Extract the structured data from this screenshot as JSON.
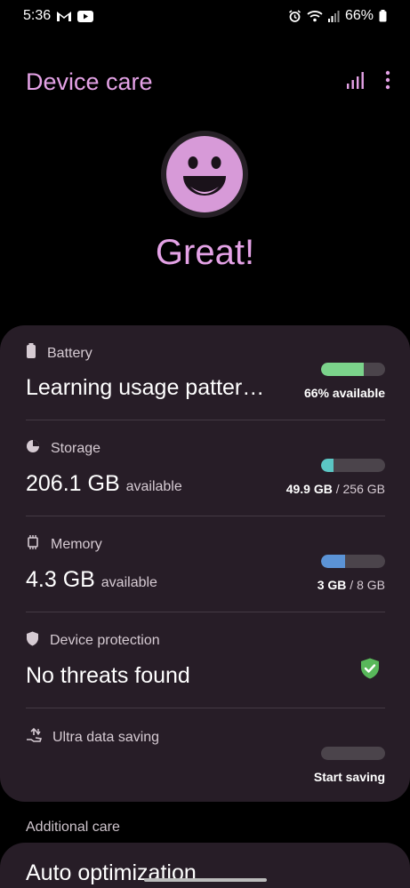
{
  "status_bar": {
    "time": "5:36",
    "battery_pct": "66%",
    "icons": [
      "gmail-icon",
      "youtube-icon",
      "alarm-icon",
      "wifi-icon",
      "signal-icon",
      "battery-icon"
    ]
  },
  "header": {
    "title": "Device care",
    "actions": [
      "performance-icon",
      "more-options-icon"
    ]
  },
  "hero": {
    "status": "Great!",
    "face_icon": "smiley-face-icon"
  },
  "colors": {
    "accent": "#e4a2e6",
    "battery_bar": "#7bd38b",
    "storage_bar": "#5bc6c4",
    "memory_bar": "#5b93d6",
    "shield_ok": "#58b75a",
    "card_bg": "#271d27"
  },
  "items": {
    "battery": {
      "label": "Battery",
      "value": "Learning usage patter…",
      "detail": "66% available",
      "fill": 0.66,
      "icon": "battery-icon"
    },
    "storage": {
      "label": "Storage",
      "value": "206.1 GB",
      "value_unit": "available",
      "detail_used": "49.9 GB",
      "detail_total": " / 256 GB",
      "fill": 0.195,
      "icon": "pie-chart-icon"
    },
    "memory": {
      "label": "Memory",
      "value": "4.3 GB",
      "value_unit": "available",
      "detail_used": "3 GB",
      "detail_total": " / 8 GB",
      "fill": 0.375,
      "icon": "chip-icon"
    },
    "protection": {
      "label": "Device protection",
      "value": "No threats found",
      "icon": "shield-icon",
      "status_icon": "shield-check-icon"
    },
    "data_saving": {
      "label": "Ultra data saving",
      "detail": "Start saving",
      "fill": 0,
      "icon": "data-saving-icon"
    }
  },
  "additional": {
    "label": "Additional care",
    "first_item": "Auto optimization"
  }
}
